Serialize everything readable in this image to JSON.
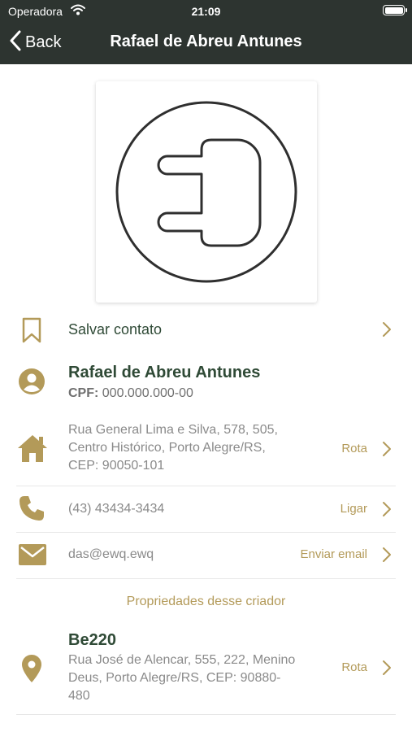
{
  "status_bar": {
    "carrier": "Operadora",
    "time": "21:09"
  },
  "nav": {
    "back_label": "Back",
    "title": "Rafael de Abreu Antunes"
  },
  "save_contact": {
    "label": "Salvar contato"
  },
  "person": {
    "name": "Rafael de Abreu Antunes",
    "cpf_label": "CPF:",
    "cpf_value": "000.000.000-00"
  },
  "address": {
    "lines": [
      "Rua General Lima e Silva, 578, 505,",
      "Centro Histórico, Porto Alegre/RS,",
      "CEP: 90050-101"
    ],
    "action": "Rota"
  },
  "phone": {
    "value": "(43) 43434-3434",
    "action": "Ligar"
  },
  "email": {
    "value": "das@ewq.ewq",
    "action": "Enviar email"
  },
  "properties": {
    "heading": "Propriedades desse criador",
    "items": [
      {
        "name": "Be220",
        "lines": [
          "Rua José de Alencar, 555, 222, Menino",
          "Deus, Porto Alegre/RS, CEP: 90880-",
          "480"
        ],
        "action": "Rota"
      }
    ]
  },
  "colors": {
    "header": "#2d3430",
    "accent": "#b39a59",
    "primary_text": "#2f4a36",
    "muted_text": "#8a8a8a"
  }
}
